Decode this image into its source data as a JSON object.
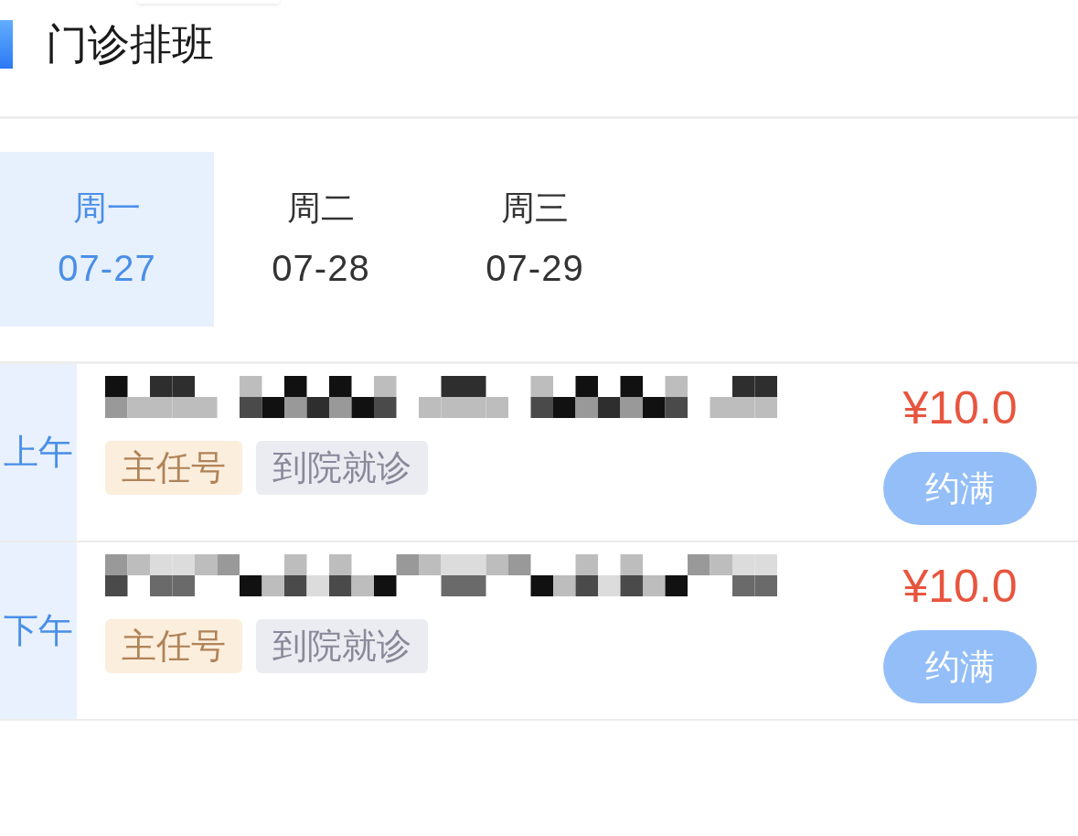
{
  "header": {
    "title": "门诊排班"
  },
  "days": [
    {
      "weekday": "周一",
      "date": "07-27",
      "selected": true
    },
    {
      "weekday": "周二",
      "date": "07-28",
      "selected": false
    },
    {
      "weekday": "周三",
      "date": "07-29",
      "selected": false
    }
  ],
  "sessions": [
    {
      "period": "上午",
      "name_pixelated": true,
      "tags": [
        {
          "kind": "level",
          "label": "主任号"
        },
        {
          "kind": "visit",
          "label": "到院就诊"
        }
      ],
      "price": "¥10.0",
      "button": {
        "label": "约满",
        "disabled": true
      }
    },
    {
      "period": "下午",
      "name_pixelated": true,
      "tags": [
        {
          "kind": "level",
          "label": "主任号"
        },
        {
          "kind": "visit",
          "label": "到院就诊"
        }
      ],
      "price": "¥10.0",
      "button": {
        "label": "约满",
        "disabled": true
      }
    }
  ]
}
